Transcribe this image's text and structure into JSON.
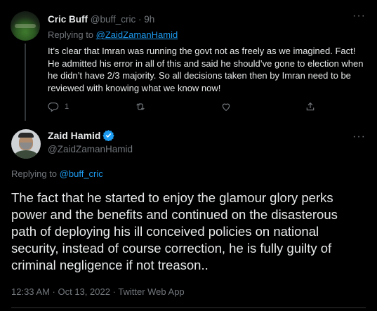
{
  "reply_tweet": {
    "display_name": "Cric Buff",
    "handle": "@buff_cric",
    "time": "9h",
    "separator": "·",
    "replying_label": "Replying to",
    "replying_to": "@ZaidZamanHamid",
    "text": "It’s clear that Imran was running the govt not as freely as we imagined. Fact! He admitted his error in all of this and said he should’ve gone to election when he didn’t have 2/3 majority. So all decisions taken then by Imran need to be reviewed with knowing what we know now!",
    "reply_count": "1",
    "more_label": "···"
  },
  "main_tweet": {
    "display_name": "Zaid Hamid",
    "handle": "@ZaidZamanHamid",
    "replying_label": "Replying to",
    "replying_to": "@buff_cric",
    "text": "The fact that he started to enjoy the glamour glory perks power and the benefits and continued on the disasterous path of deploying his ill conceived policies on national security, instead of course correction, he is fully guilty of criminal negligence if not treason..",
    "timestamp": "12:33 AM · Oct 13, 2022 · Twitter Web App",
    "more_label": "···"
  },
  "colors": {
    "background": "#000000",
    "text": "#e7e9ea",
    "secondary": "#71767b",
    "link": "#1d9bf0",
    "verified": "#1d9bf0"
  }
}
